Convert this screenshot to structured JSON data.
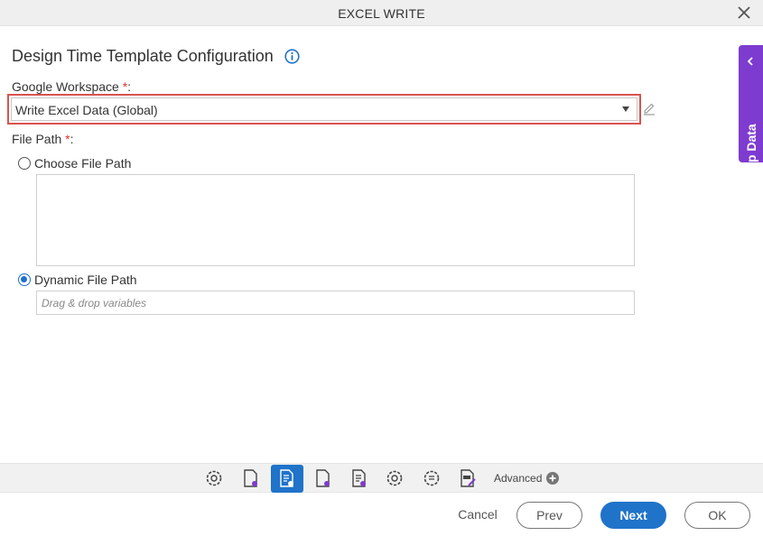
{
  "window": {
    "title": "EXCEL WRITE"
  },
  "form": {
    "heading": "Design Time Template Configuration",
    "workspace": {
      "label": "Google Workspace",
      "required_mark": "*",
      "colon": ":",
      "selected_value": "Write Excel Data (Global)"
    },
    "file_path": {
      "label": "File Path",
      "required_mark": "*",
      "colon": ":",
      "options": [
        {
          "label": "Choose File Path",
          "checked": false
        },
        {
          "label": "Dynamic File Path",
          "checked": true
        }
      ],
      "dynamic_placeholder": "Drag & drop variables"
    }
  },
  "side_tab": {
    "label": "App Data"
  },
  "toolbar": {
    "advanced_label": "Advanced"
  },
  "footer": {
    "cancel": "Cancel",
    "prev": "Prev",
    "next": "Next",
    "ok": "OK"
  },
  "colors": {
    "accent": "#1f73c9",
    "side_tab": "#7e3bd0",
    "highlight": "#d9534f",
    "required": "#d9342b"
  }
}
